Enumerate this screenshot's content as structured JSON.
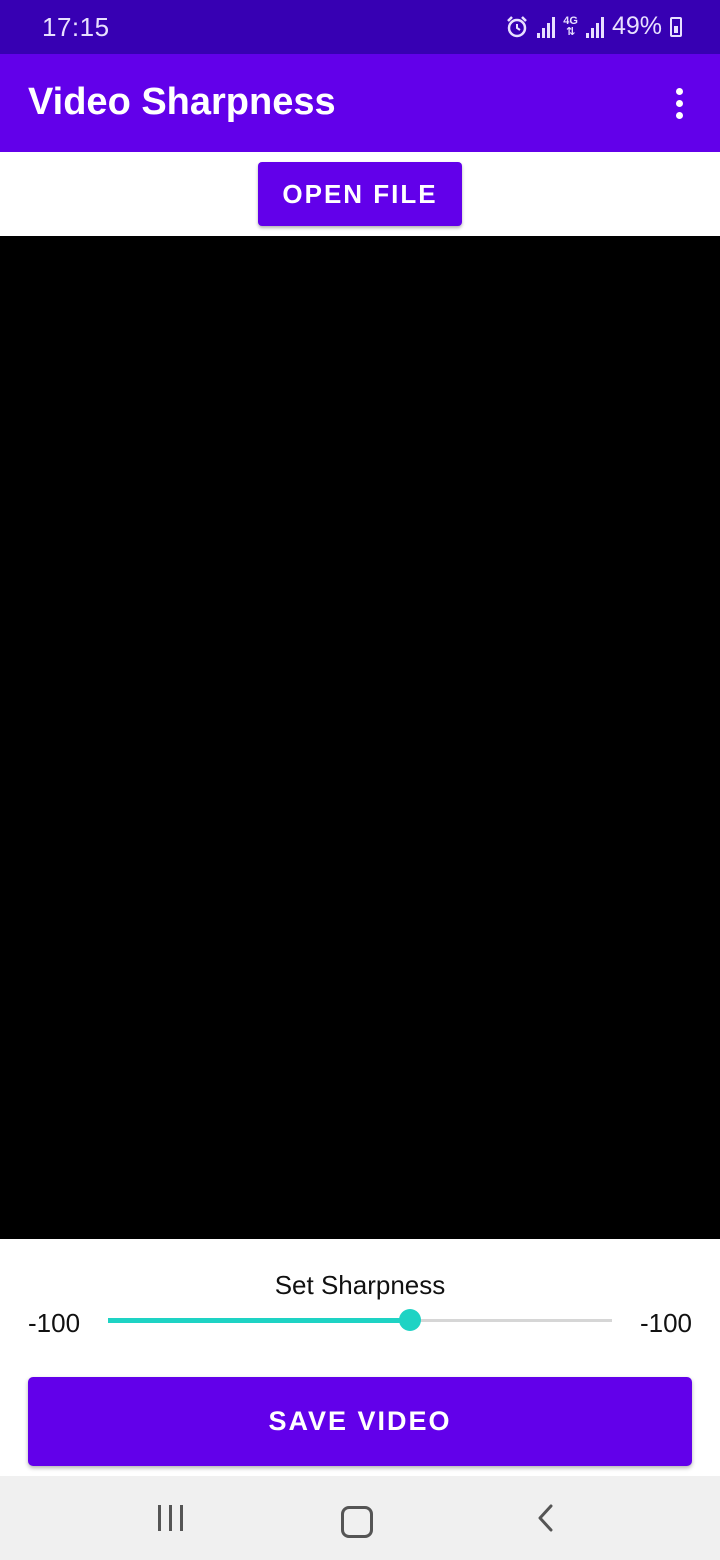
{
  "status_bar": {
    "time": "17:15",
    "network_label": "4G",
    "battery": "49%",
    "icons": [
      "alarm-icon",
      "signal-icon",
      "4g-data-icon",
      "signal-icon",
      "battery-charging-icon"
    ]
  },
  "app_bar": {
    "title": "Video Sharpness",
    "menu_icon": "more-vert-icon"
  },
  "toolbar": {
    "open_file_label": "OPEN FILE"
  },
  "video": {
    "background": "#000000"
  },
  "sharpness": {
    "label": "Set Sharpness",
    "min_label": "-100",
    "max_label": "-100",
    "slider_fraction": 0.6
  },
  "actions": {
    "save_video_label": "SAVE VIDEO"
  },
  "navigation": {
    "icons": [
      "recents-icon",
      "home-icon",
      "back-icon"
    ]
  },
  "colors": {
    "status_bar": "#3700b3",
    "primary": "#6200ea",
    "accent": "#1ed3c4",
    "nav_bar": "#f0f0f0"
  }
}
